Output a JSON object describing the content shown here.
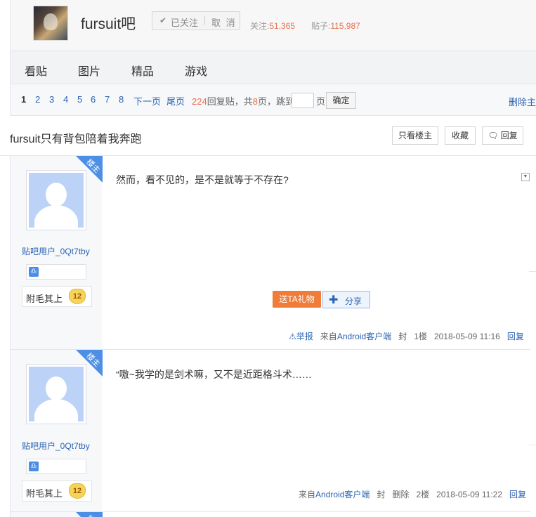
{
  "forum": {
    "name": "fursuit吧",
    "follow_label": "已关注",
    "unfollow_label": "取 消",
    "followers_label": "关注:",
    "followers_count": "51,365",
    "posts_label": "贴子:",
    "posts_count": "115,987"
  },
  "nav": {
    "items": [
      "看贴",
      "图片",
      "精品",
      "游戏"
    ]
  },
  "pager": {
    "pages": [
      "1",
      "2",
      "3",
      "4",
      "5",
      "6",
      "7",
      "8"
    ],
    "current": "1",
    "next_label": "下一页",
    "last_label": "尾页",
    "reply_count": "224",
    "reply_suffix": "回复贴，共",
    "page_total": "8",
    "page_suffix": "页，跳到",
    "page_unit": "页",
    "ok_label": "确定",
    "delete_label": "删除主题"
  },
  "thread": {
    "title": "fursuit只有背包陪着我奔跑",
    "only_op_label": "只看楼主",
    "favorite_label": "收藏",
    "reply_label": "回复"
  },
  "posts": [
    {
      "ribbon": "楼主",
      "username": "贴吧用户_0Qt7tby",
      "badge_glyph": "♎",
      "level_name": "附毛其上",
      "level": "12",
      "content": "然而，看不见的，是不是就等于不存在?",
      "gift_label": "送TA礼物",
      "share_label": "分享",
      "report_label": "举报",
      "source_prefix": "来自",
      "source_client": "Android客户端",
      "seal_label": "封",
      "floor": "1楼",
      "time": "2018-05-09 11:16",
      "reply_label": "回复"
    },
    {
      "ribbon": "楼主",
      "username": "贴吧用户_0Qt7tby",
      "badge_glyph": "♎",
      "level_name": "附毛其上",
      "level": "12",
      "content": "“嗷~我学的是剑术嘛，又不是近距格斗术……",
      "source_prefix": "来自",
      "source_client": "Android客户端",
      "seal_label": "封",
      "delete_label": "删除",
      "floor": "2楼",
      "time": "2018-05-09 11:22",
      "reply_label": "回复"
    },
    {
      "ribbon": "楼主"
    }
  ],
  "icons": {
    "follow": "check-icon",
    "report": "warning-triangle-icon",
    "share": "plus-icon",
    "reply": "comment-icon",
    "dropdown": "chevron-down-icon"
  },
  "colors": {
    "link": "#2d64b3",
    "accent_orange": "#e9704a",
    "gift_button": "#f07c39",
    "ribbon_blue": "#4d8fe5",
    "avatar_blue": "#bcd3f7"
  }
}
